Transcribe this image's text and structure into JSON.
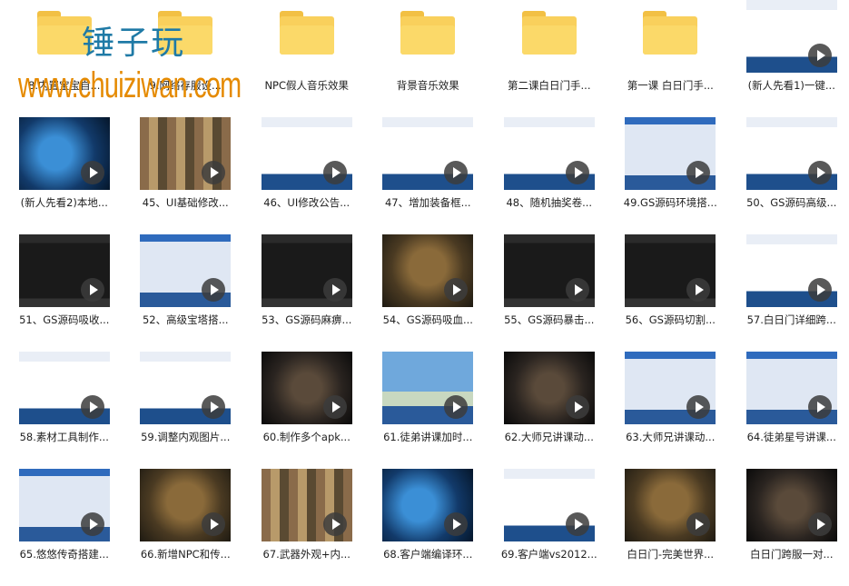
{
  "watermark": {
    "cn": "锤子玩",
    "url": "www.chuiziwan.com"
  },
  "items": [
    {
      "label": "8.内置宝宝自...",
      "type": "folder"
    },
    {
      "label": "9.网络存服设...",
      "type": "folder"
    },
    {
      "label": "NPC假人音乐效果",
      "type": "folder"
    },
    {
      "label": "背景音乐效果",
      "type": "folder"
    },
    {
      "label": "第二课白日门手...",
      "type": "folder"
    },
    {
      "label": "第一课 白日门手...",
      "type": "folder"
    },
    {
      "label": "(新人先看1)一键...",
      "type": "video",
      "style": "windows"
    },
    {
      "label": "(新人先看2)本地...",
      "type": "video",
      "style": "game-blue"
    },
    {
      "label": "45、UI基础修改...",
      "type": "video",
      "style": "icons"
    },
    {
      "label": "46、UI修改公告...",
      "type": "video",
      "style": "windows"
    },
    {
      "label": "47、增加装备框...",
      "type": "video",
      "style": "windows"
    },
    {
      "label": "48、随机抽奖卷...",
      "type": "video",
      "style": "windows"
    },
    {
      "label": "49.GS源码环境搭...",
      "type": "video",
      "style": "windows-blue"
    },
    {
      "label": "50、GS源码高级...",
      "type": "video",
      "style": "windows"
    },
    {
      "label": "51、GS源码吸收...",
      "type": "video",
      "style": "dark-ide"
    },
    {
      "label": "52、高级宝塔搭...",
      "type": "video",
      "style": "windows-blue"
    },
    {
      "label": "53、GS源码麻痹...",
      "type": "video",
      "style": "dark-ide"
    },
    {
      "label": "54、GS源码吸血...",
      "type": "video",
      "style": "game"
    },
    {
      "label": "55、GS源码暴击...",
      "type": "video",
      "style": "dark-ide"
    },
    {
      "label": "56、GS源码切割...",
      "type": "video",
      "style": "dark-ide"
    },
    {
      "label": "57.白日门详细跨...",
      "type": "video",
      "style": "windows"
    },
    {
      "label": "58.素材工具制作...",
      "type": "video",
      "style": "windows"
    },
    {
      "label": "59.调整内观图片...",
      "type": "video",
      "style": "windows"
    },
    {
      "label": "60.制作多个apk...",
      "type": "video",
      "style": "game-dark"
    },
    {
      "label": "61.徒弟讲课加时...",
      "type": "video",
      "style": "sky"
    },
    {
      "label": "62.大师兄讲课动...",
      "type": "video",
      "style": "game-dark"
    },
    {
      "label": "63.大师兄讲课动...",
      "type": "video",
      "style": "windows-blue"
    },
    {
      "label": "64.徒弟星号讲课...",
      "type": "video",
      "style": "windows-blue"
    },
    {
      "label": "65.悠悠传奇搭建...",
      "type": "video",
      "style": "windows-blue"
    },
    {
      "label": "66.新增NPC和传...",
      "type": "video",
      "style": "game"
    },
    {
      "label": "67.武器外观+内...",
      "type": "video",
      "style": "icons"
    },
    {
      "label": "68.客户端编译环...",
      "type": "video",
      "style": "game-blue"
    },
    {
      "label": "69.客户端vs2012...",
      "type": "video",
      "style": "windows"
    },
    {
      "label": "白日门-完美世界...",
      "type": "video",
      "style": "game"
    },
    {
      "label": "白日门跨服一对...",
      "type": "video",
      "style": "game-dark"
    }
  ]
}
